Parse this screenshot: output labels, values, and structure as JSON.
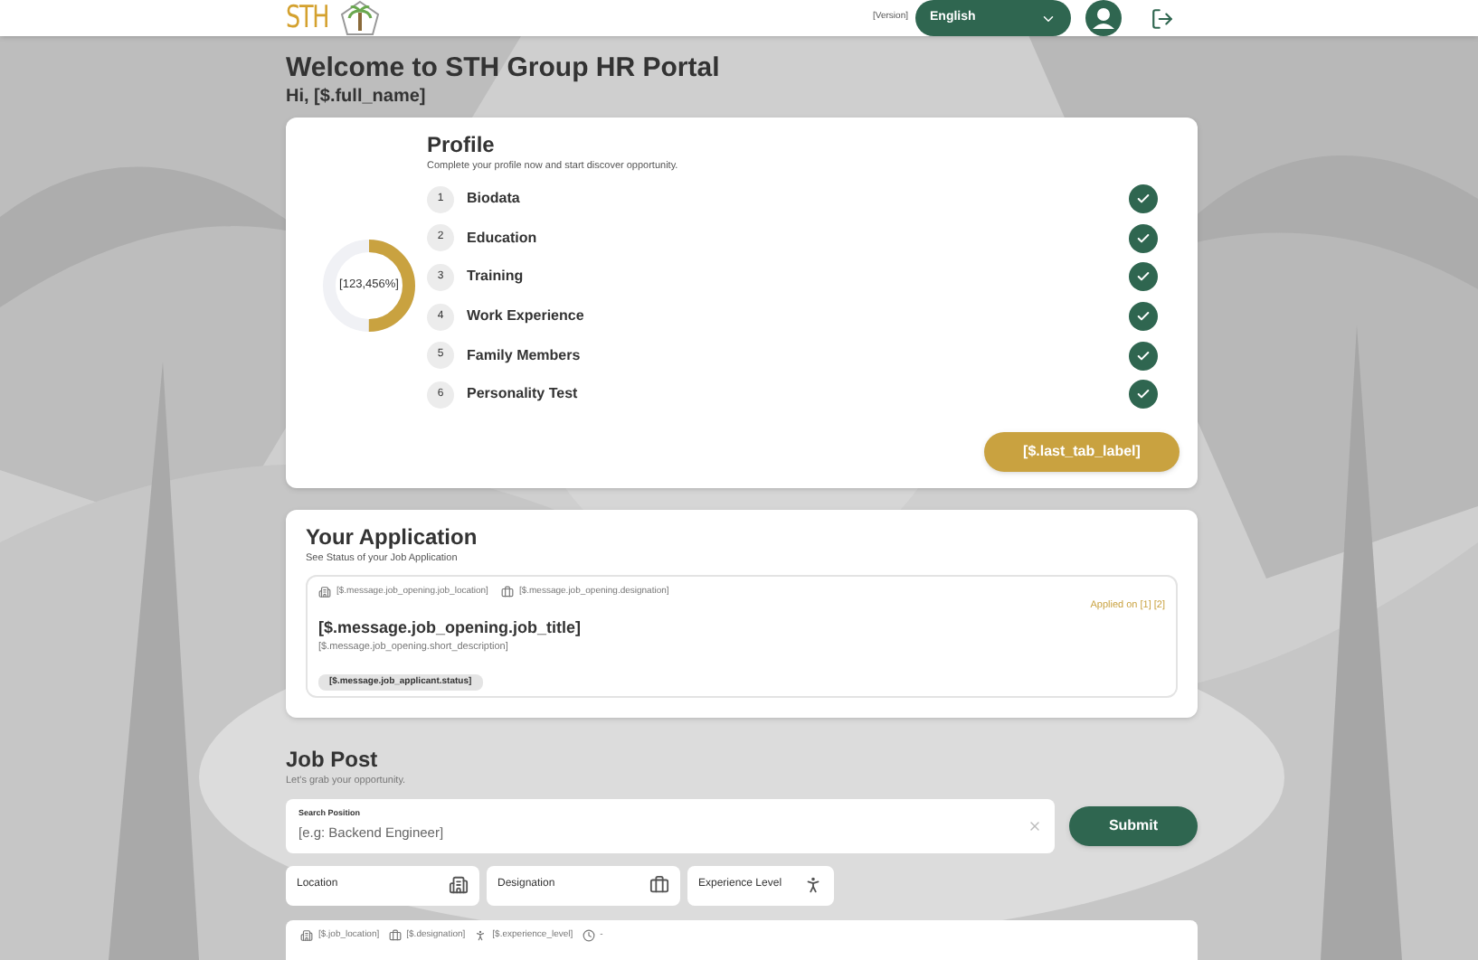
{
  "header": {
    "logo": "STH",
    "version": "[Version]",
    "language": "English"
  },
  "welcome": {
    "title": "Welcome to STH Group HR Portal",
    "greeting": "Hi,  [$.full_name]"
  },
  "profile": {
    "title": "Profile",
    "subtitle": "Complete your profile now and start discover opportunity.",
    "progress_label": "[123,456%]",
    "level": 0.5,
    "steps": [
      {
        "number": "1",
        "label": "Biodata",
        "completed": true
      },
      {
        "number": "2",
        "label": "Education",
        "completed": true
      },
      {
        "number": "3",
        "label": "Training",
        "completed": true
      },
      {
        "number": "4",
        "label": "Work Experience",
        "completed": true
      },
      {
        "number": "5",
        "label": "Family Members",
        "completed": true
      },
      {
        "number": "6",
        "label": "Personality Test",
        "completed": true
      }
    ],
    "button": "[$.last_tab_label]"
  },
  "application": {
    "title": "Your Application",
    "subtitle": "See Status of your Job Application",
    "card": {
      "location": "[$.message.job_opening.job_location]",
      "designation": "[$.message.job_opening.designation]",
      "applied_on": "Applied on [1] [2]",
      "job_title": "[$.message.job_opening.job_title]",
      "description": "[$.message.job_opening.short_description]",
      "status": "[$.message.job_applicant.status]"
    }
  },
  "job_post": {
    "title": "Job Post",
    "subtitle": "Let's grab your opportunity.",
    "search": {
      "label": "Search Position",
      "placeholder": "[e.g: Backend Engineer]"
    },
    "submit": "Submit",
    "filters": [
      {
        "label": "Location",
        "kind": "building"
      },
      {
        "label": "Designation",
        "kind": "briefcase"
      },
      {
        "label": "Experience Level",
        "kind": "figure"
      }
    ],
    "post": {
      "location": "[$.job_location]",
      "designation": "[$.designation]",
      "experience": "[$.experience_level]",
      "time": "-"
    }
  }
}
